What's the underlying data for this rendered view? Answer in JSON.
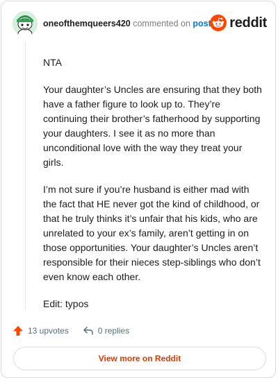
{
  "header": {
    "username": "oneofthemqueers420",
    "commented_text": "commented on",
    "post_link": "post",
    "brand_word": "reddit"
  },
  "comment": {
    "paragraphs": [
      "NTA",
      "Your daughter’s Uncles are ensuring that they both have a father figure to look up to. They’re continuing their brother’s fatherhood by supporting your daughters. I see it as no more than unconditional love with the way they treat your girls.",
      "I’m not sure if you’re husband is either mad with the fact that HE never got the kind of childhood, or that he truly thinks it’s unfair that his kids, who are unrelated to your ex’s family, aren’t getting in on those opportunities. Your daughter’s Uncles aren’t responsible for their nieces step-siblings who don’t even know each other.",
      "Edit: typos"
    ]
  },
  "actions": {
    "upvotes": "13 upvotes",
    "replies": "0 replies"
  },
  "view_more": "View more on Reddit",
  "colors": {
    "upvote": "#ff4500",
    "link": "#0079d3",
    "view_more": "#d93a00",
    "brand": "#ff4500"
  }
}
